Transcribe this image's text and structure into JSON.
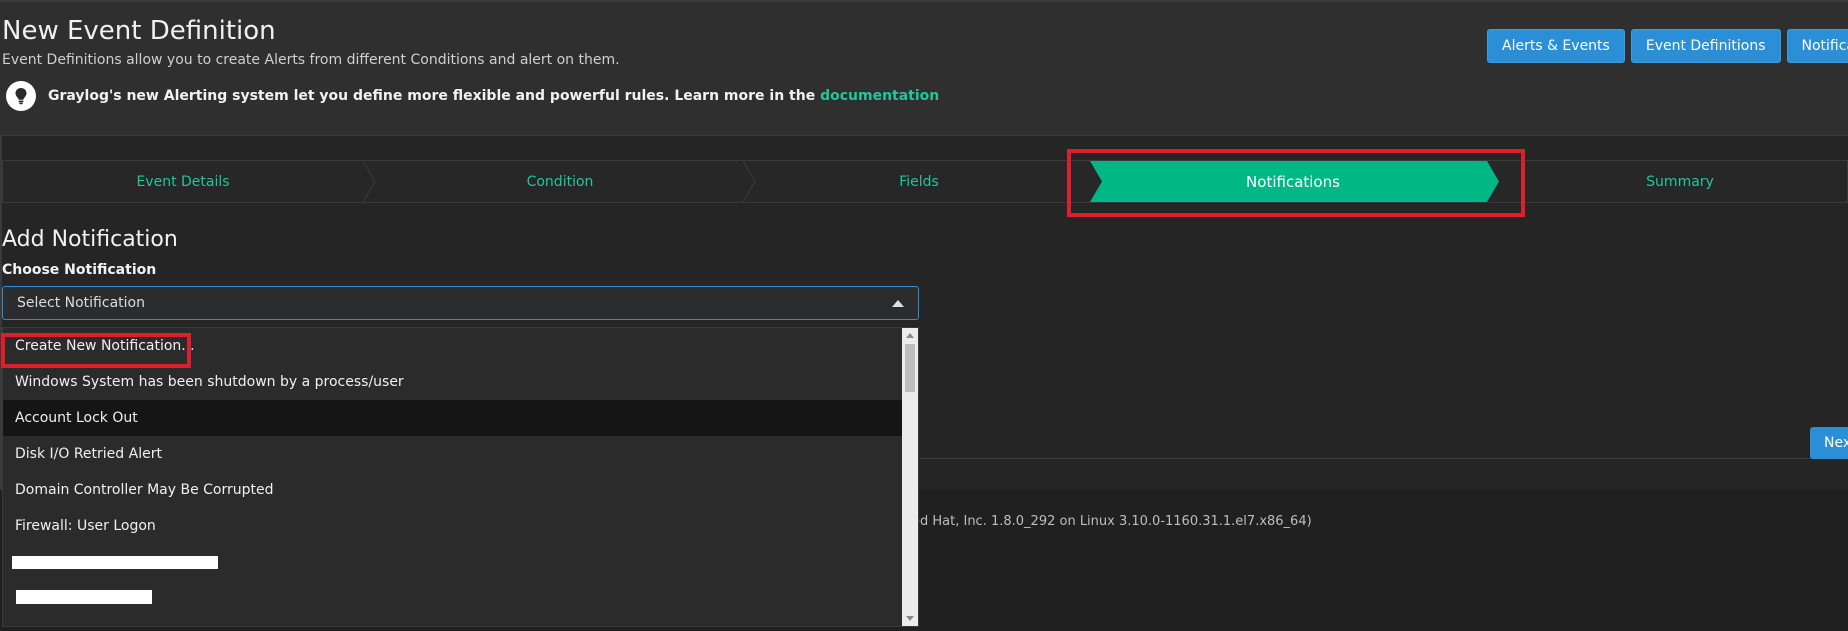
{
  "header": {
    "title": "New Event Definition",
    "description": "Event Definitions allow you to create Alerts from different Conditions and alert on them.",
    "tip_text": "Graylog's new Alerting system let you define more flexible and powerful rules. Learn more in the",
    "tip_link": "documentation",
    "buttons": [
      "Alerts & Events",
      "Event Definitions",
      "Notifications"
    ]
  },
  "wizard": {
    "steps": [
      "Event Details",
      "Condition",
      "Fields",
      "Notifications",
      "Summary"
    ],
    "active_step": "Notifications",
    "colors": {
      "step_text": "#1fc79a",
      "active_bg": "#00b886",
      "highlight": "#dc1f2c"
    }
  },
  "add_notification": {
    "title": "Add Notification",
    "label": "Choose Notification",
    "select_placeholder": "Select Notification",
    "options": [
      "Create New Notification...",
      "Windows System has been shutdown by a process/user",
      "Account Lock Out",
      "Disk I/O Retried Alert",
      "Domain Controller May Be Corrupted",
      "Firewall: User Logon"
    ],
    "hovered_option": "Account Lock Out",
    "next_button": "Nex"
  },
  "footer": {
    "version_text": "ed Hat, Inc. 1.8.0_292 on Linux 3.10.0-1160.31.1.el7.x86_64)"
  }
}
